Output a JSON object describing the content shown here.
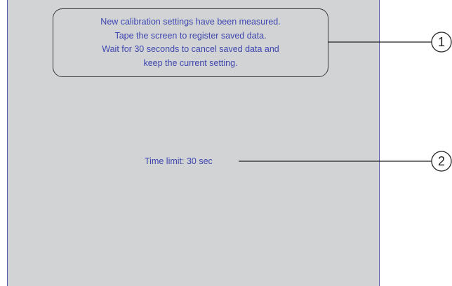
{
  "message": {
    "lines": [
      "New calibration settings have been measured.",
      "Tape the screen to register saved data.",
      "Wait for 30 seconds to cancel saved data and",
      "keep the current setting."
    ]
  },
  "time_limit": {
    "label": "Time limit: 30 sec"
  },
  "callouts": [
    "1",
    "2"
  ],
  "colors": {
    "screen_bg": "#d2d3d5",
    "text": "#3e46b0",
    "border": "#3a3a3a"
  }
}
